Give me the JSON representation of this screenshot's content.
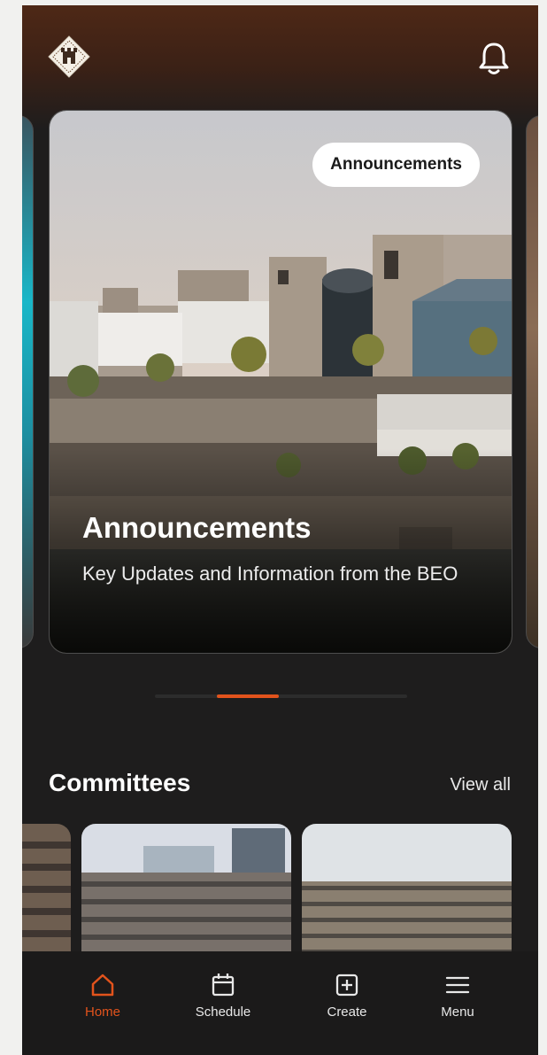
{
  "header": {
    "logo_icon": "crest-logo-icon",
    "notification_icon": "bell-icon"
  },
  "carousel": {
    "active_index": 1,
    "card": {
      "badge": "Announcements",
      "title": "Announcements",
      "subtitle": "Key Updates and Information from the BEO"
    }
  },
  "committees": {
    "title": "Committees",
    "view_all": "View all"
  },
  "bottom_nav": {
    "items": [
      {
        "label": "Home",
        "icon": "home-icon",
        "active": true
      },
      {
        "label": "Schedule",
        "icon": "calendar-icon",
        "active": false
      },
      {
        "label": "Create",
        "icon": "plus-square-icon",
        "active": false
      },
      {
        "label": "Menu",
        "icon": "menu-icon",
        "active": false
      }
    ]
  },
  "colors": {
    "accent": "#e2531c",
    "background": "#1e1d1d",
    "header_brown": "#4e2816"
  }
}
